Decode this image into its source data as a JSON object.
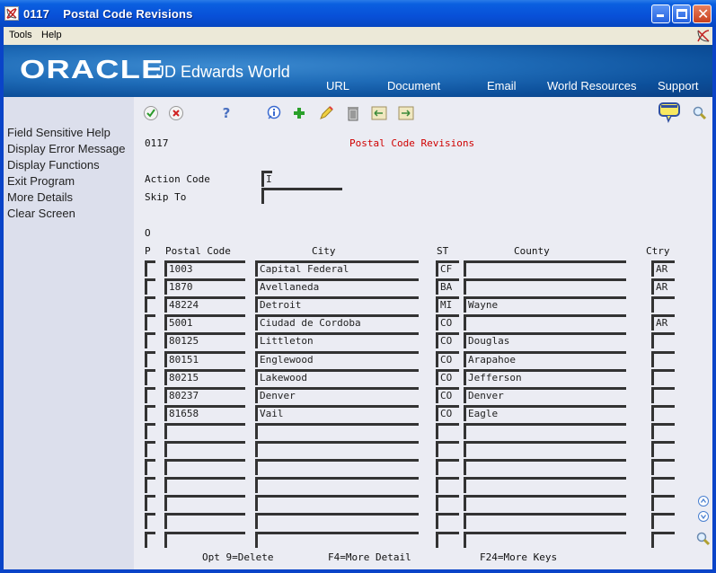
{
  "window": {
    "title": "0117    Postal Code Revisions",
    "icon": "jde-logo-icon",
    "controls": [
      "minimize",
      "maximize",
      "close"
    ]
  },
  "menu": {
    "items": [
      {
        "label": "Tools",
        "accel": "T"
      },
      {
        "label": "Help",
        "accel": "H"
      }
    ]
  },
  "banner": {
    "brand": "ORACLE",
    "product": "JD Edwards World",
    "nav": [
      "URL",
      "Document",
      "Email",
      "World Resources",
      "Support"
    ]
  },
  "sidebar": {
    "items": [
      {
        "label": "Field Sensitive Help"
      },
      {
        "label": "Display Error Message"
      },
      {
        "label": "Display Functions"
      },
      {
        "label": "Exit Program"
      },
      {
        "label": "More Details"
      },
      {
        "label": "Clear Screen"
      }
    ]
  },
  "toolbar": {
    "icons": [
      "check-icon",
      "cancel-icon",
      "help-icon",
      "info-icon",
      "add-icon",
      "edit-icon",
      "delete-icon",
      "prev-record-icon",
      "next-record-icon"
    ],
    "right_icons": [
      "message-icon",
      "search-icon"
    ]
  },
  "form": {
    "program_id": "0117",
    "form_title": "Postal Code Revisions",
    "action_code_label": "Action Code",
    "action_code_value": "I",
    "skip_to_label": "Skip To",
    "skip_to_value": ""
  },
  "grid": {
    "headers": {
      "opt_top": "O",
      "opt": "P",
      "postal_code": "Postal Code",
      "city": "City",
      "state": "ST",
      "county": "County",
      "country": "Ctry"
    },
    "rows": [
      {
        "opt": "",
        "postal_code": "1003",
        "city": "Capital Federal",
        "state": "CF",
        "county": "",
        "country": "AR"
      },
      {
        "opt": "",
        "postal_code": "1870",
        "city": "Avellaneda",
        "state": "BA",
        "county": "",
        "country": "AR"
      },
      {
        "opt": "",
        "postal_code": "48224",
        "city": "Detroit",
        "state": "MI",
        "county": "Wayne",
        "country": ""
      },
      {
        "opt": "",
        "postal_code": "5001",
        "city": "Ciudad de Cordoba",
        "state": "CO",
        "county": "",
        "country": "AR"
      },
      {
        "opt": "",
        "postal_code": "80125",
        "city": "Littleton",
        "state": "CO",
        "county": "Douglas",
        "country": ""
      },
      {
        "opt": "",
        "postal_code": "80151",
        "city": "Englewood",
        "state": "CO",
        "county": "Arapahoe",
        "country": ""
      },
      {
        "opt": "",
        "postal_code": "80215",
        "city": "Lakewood",
        "state": "CO",
        "county": "Jefferson",
        "country": ""
      },
      {
        "opt": "",
        "postal_code": "80237",
        "city": "Denver",
        "state": "CO",
        "county": "Denver",
        "country": ""
      },
      {
        "opt": "",
        "postal_code": "81658",
        "city": "Vail",
        "state": "CO",
        "county": "Eagle",
        "country": ""
      },
      {
        "opt": "",
        "postal_code": "",
        "city": "",
        "state": "",
        "county": "",
        "country": ""
      },
      {
        "opt": "",
        "postal_code": "",
        "city": "",
        "state": "",
        "county": "",
        "country": ""
      },
      {
        "opt": "",
        "postal_code": "",
        "city": "",
        "state": "",
        "county": "",
        "country": ""
      },
      {
        "opt": "",
        "postal_code": "",
        "city": "",
        "state": "",
        "county": "",
        "country": ""
      },
      {
        "opt": "",
        "postal_code": "",
        "city": "",
        "state": "",
        "county": "",
        "country": ""
      },
      {
        "opt": "",
        "postal_code": "",
        "city": "",
        "state": "",
        "county": "",
        "country": ""
      },
      {
        "opt": "",
        "postal_code": "",
        "city": "",
        "state": "",
        "county": "",
        "country": ""
      }
    ]
  },
  "footer": {
    "keys": [
      "Opt 9=Delete",
      "F4=More Detail",
      "F24=More Keys"
    ]
  },
  "scroll": {
    "icons": [
      "page-up-icon",
      "page-down-icon",
      "zoom-search-icon"
    ]
  }
}
